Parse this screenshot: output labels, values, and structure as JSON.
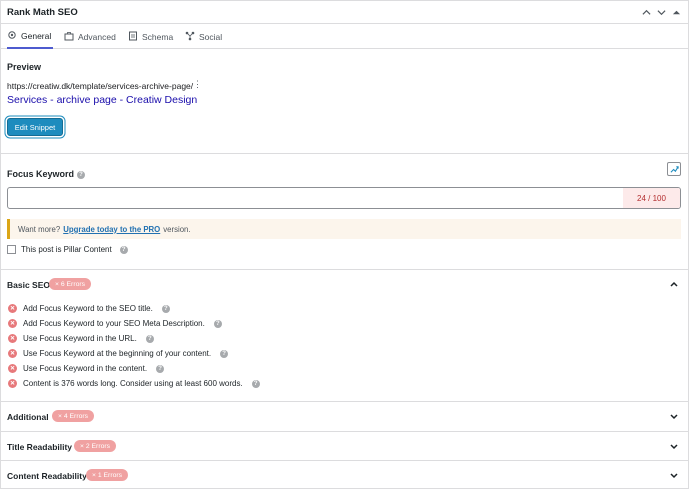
{
  "panel": {
    "title": "Rank Math SEO"
  },
  "tabs": [
    {
      "label": "General",
      "icon": "gear-icon"
    },
    {
      "label": "Advanced",
      "icon": "toolbox-icon"
    },
    {
      "label": "Schema",
      "icon": "schema-icon"
    },
    {
      "label": "Social",
      "icon": "social-icon"
    }
  ],
  "preview": {
    "label": "Preview",
    "url": "https://creatiw.dk/template/services-archive-page/",
    "title": "Services - archive page - Creatiw Design",
    "edit_button": "Edit Snippet"
  },
  "focus_keyword": {
    "label": "Focus Keyword",
    "value": "",
    "counter": "24 / 100"
  },
  "notice": {
    "prefix": "Want more?",
    "link": "Upgrade today to the PRO",
    "suffix": "version."
  },
  "pillar": {
    "label": "This post is Pillar Content"
  },
  "basic_seo": {
    "title": "Basic SEO",
    "badge": "× 6 Errors",
    "items": [
      "Add Focus Keyword to the SEO title.",
      "Add Focus Keyword to your SEO Meta Description.",
      "Use Focus Keyword in the URL.",
      "Use Focus Keyword at the beginning of your content.",
      "Use Focus Keyword in the content.",
      "Content is 376 words long. Consider using at least 600 words."
    ]
  },
  "additional": {
    "title": "Additional",
    "badge": "× 4 Errors"
  },
  "title_readability": {
    "title": "Title Readability",
    "badge": "× 2 Errors"
  },
  "content_readability": {
    "title": "Content Readability",
    "badge": "× 1 Errors"
  },
  "colors": {
    "accent": "#4e5bcf",
    "button": "#1e8cbe",
    "error": "#e7797b",
    "link": "#1a0dab"
  }
}
